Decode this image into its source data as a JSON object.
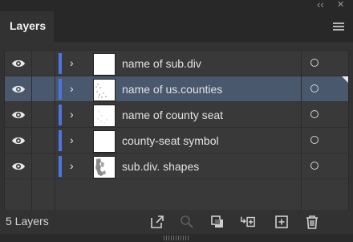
{
  "window_controls": {
    "collapse_glyph": "‹‹",
    "close_glyph": "✕"
  },
  "panel": {
    "tab_title": "Layers"
  },
  "layers": [
    {
      "name": "name of sub.div",
      "selected": false,
      "thumb": "blank"
    },
    {
      "name": "name of us.counties",
      "selected": true,
      "thumb": "dots"
    },
    {
      "name": "name of county seat",
      "selected": false,
      "thumb": "dots-light"
    },
    {
      "name": "county-seat symbol",
      "selected": false,
      "thumb": "blank"
    },
    {
      "name": "sub.div. shapes",
      "selected": false,
      "thumb": "map"
    }
  ],
  "layer_glyphs": {
    "expand": "›"
  },
  "footer": {
    "layer_count": "5 Layers"
  },
  "colors": {
    "layer_color": "#4e74e0",
    "selection": "#49586d",
    "panel_bg": "#323232"
  }
}
